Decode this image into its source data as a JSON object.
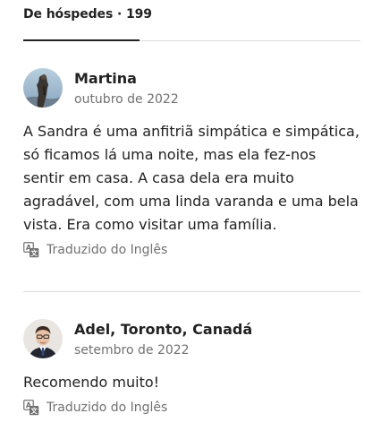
{
  "tabs": {
    "active_label": "De hóspedes · 199"
  },
  "reviews": [
    {
      "name": "Martina",
      "date": "outubro de 2022",
      "text": "A Sandra é uma anfitriã simpática e simpática, só ficamos lá uma noite, mas ela fez-nos sentir em casa. A casa dela era muito agradável, com uma linda varanda e uma bela vista. Era como visitar uma família.",
      "translated_label": "Traduzido do Inglês"
    },
    {
      "name": "Adel, Toronto, Canadá",
      "date": "setembro de 2022",
      "text": "Recomendo muito!",
      "translated_label": "Traduzido do Inglês"
    }
  ],
  "icons": {
    "translate": "translate-icon"
  },
  "colors": {
    "text_primary": "#222222",
    "text_secondary": "#717171",
    "divider": "#dddddd"
  }
}
